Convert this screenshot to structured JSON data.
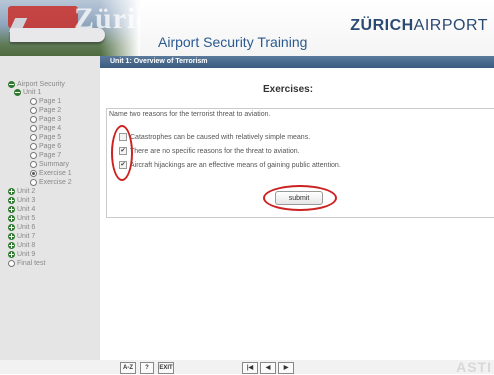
{
  "header": {
    "banner_text": "Zürich",
    "app_title": "Airport Security Training",
    "logo_primary": "ZÜRICH",
    "logo_secondary": "AIRPORT"
  },
  "unit_bar": {
    "label": "Unit 1: Overview of Terrorism"
  },
  "nav": {
    "root": "Airport Security",
    "unit1": "Unit 1",
    "pages": [
      "Page 1",
      "Page 2",
      "Page 3",
      "Page 4",
      "Page 5",
      "Page 6",
      "Page 7"
    ],
    "summary": "Summary",
    "exercise1": "Exercise 1",
    "exercise2": "Exercise 2",
    "units": [
      "Unit 2",
      "Unit 3",
      "Unit 4",
      "Unit 5",
      "Unit 6",
      "Unit 7",
      "Unit 8",
      "Unit 9"
    ],
    "final_test": "Final test"
  },
  "exercise": {
    "title": "Exercises:",
    "question": "Name two reasons for the terrorist threat to aviation.",
    "options": [
      {
        "label": "Catastrophes can be caused with relatively simple means.",
        "checked": false
      },
      {
        "label": "There are no specific reasons for the threat to aviation.",
        "checked": true
      },
      {
        "label": "Aircraft hijackings are an effective means of gaining public attention.",
        "checked": true
      }
    ],
    "submit_label": "submit"
  },
  "footer": {
    "az_label": "A-Z",
    "help_label": "?",
    "exit_label": "EXIT",
    "first_label": "|◀",
    "prev_label": "◀",
    "next_label": "▶",
    "brand_partial": "ASTI"
  },
  "colors": {
    "title_blue": "#2a5a90",
    "unit_bar": "#4a6a8e",
    "highlight_red": "#cc2222",
    "nav_green": "#2f7a2f"
  }
}
